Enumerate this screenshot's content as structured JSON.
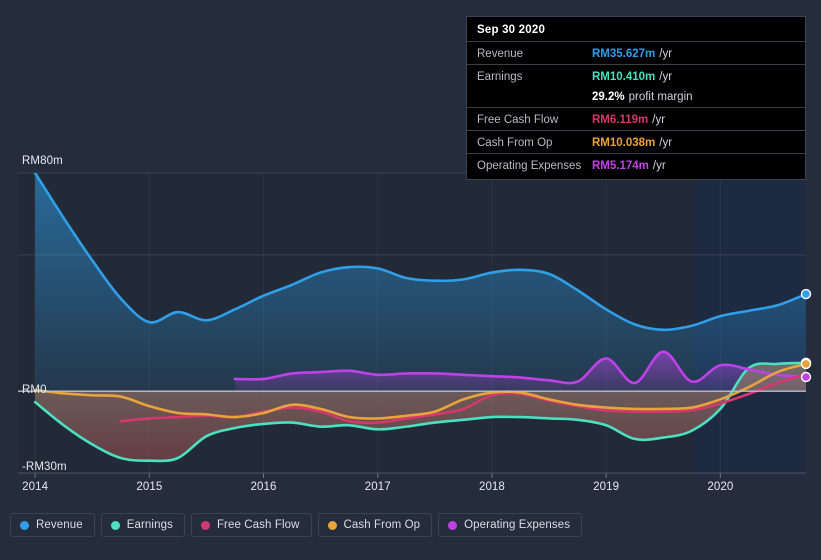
{
  "colors": {
    "background": "#252d3d",
    "plot_background": "#222a38",
    "forecast_background": "#1b2537",
    "gridline": "#3b4354",
    "zero_line": "#b9c0cc",
    "revenue": "#2e9fe8",
    "earnings": "#4ae0c0",
    "free_cash_flow": "#d6376f",
    "cash_from_op": "#e8a33d",
    "operating_expenses": "#bf42e8",
    "tooltip_bg": "#000000",
    "tooltip_border": "#3a4254",
    "text": "#e6e9ef",
    "text_muted": "#b7bcc6"
  },
  "tooltip": {
    "date": "Sep 30 2020",
    "rows": [
      {
        "name": "Revenue",
        "value": "RM35.627m",
        "unit": "/yr",
        "color": "#2e9fe8"
      },
      {
        "name": "Earnings",
        "value": "RM10.410m",
        "unit": "/yr",
        "color": "#4ae0c0"
      },
      {
        "name": "",
        "value": "29.2%",
        "unit": "profit margin",
        "color": "#ffffff",
        "sub": true
      },
      {
        "name": "Free Cash Flow",
        "value": "RM6.119m",
        "unit": "/yr",
        "color": "#d6376f"
      },
      {
        "name": "Cash From Op",
        "value": "RM10.038m",
        "unit": "/yr",
        "color": "#e8a33d"
      },
      {
        "name": "Operating Expenses",
        "value": "RM5.174m",
        "unit": "/yr",
        "color": "#bf42e8"
      }
    ]
  },
  "legend": {
    "items": [
      {
        "label": "Revenue",
        "color": "#2e9fe8",
        "icon": "legend-dot-icon"
      },
      {
        "label": "Earnings",
        "color": "#4ae0c0",
        "icon": "legend-dot-icon"
      },
      {
        "label": "Free Cash Flow",
        "color": "#d6376f",
        "icon": "legend-dot-icon"
      },
      {
        "label": "Cash From Op",
        "color": "#e8a33d",
        "icon": "legend-dot-icon"
      },
      {
        "label": "Operating Expenses",
        "color": "#bf42e8",
        "icon": "legend-dot-icon"
      }
    ]
  },
  "chart_data": {
    "type": "area",
    "title": "",
    "xlabel": "",
    "ylabel": "",
    "currency": "RM",
    "units": "m",
    "grid": true,
    "legend_position": "bottom",
    "ylim": [
      -30,
      80
    ],
    "xlim": [
      2013.85,
      2020.75
    ],
    "y_ticks": [
      {
        "value": 80,
        "label": "RM80m"
      },
      {
        "value": 50,
        "label": ""
      },
      {
        "value": 0,
        "label": "RM0"
      },
      {
        "value": -30,
        "label": "-RM30m"
      }
    ],
    "x_ticks": [
      {
        "value": 2014,
        "label": "2014"
      },
      {
        "value": 2015,
        "label": "2015"
      },
      {
        "value": 2016,
        "label": "2016"
      },
      {
        "value": 2017,
        "label": "2017"
      },
      {
        "value": 2018,
        "label": "2018"
      },
      {
        "value": 2019,
        "label": "2019"
      },
      {
        "value": 2020,
        "label": "2020"
      }
    ],
    "forecast_region": {
      "from": 2019.77,
      "to": 2020.75
    },
    "series": [
      {
        "name": "Revenue",
        "color": "#2e9fe8",
        "fill": true,
        "end_marker": true,
        "x": [
          2014.0,
          2014.25,
          2014.5,
          2014.75,
          2015.0,
          2015.25,
          2015.5,
          2015.75,
          2016.0,
          2016.25,
          2016.5,
          2016.75,
          2017.0,
          2017.25,
          2017.5,
          2017.75,
          2018.0,
          2018.25,
          2018.5,
          2018.75,
          2019.0,
          2019.25,
          2019.5,
          2019.75,
          2020.0,
          2020.25,
          2020.5,
          2020.75
        ],
        "y": [
          80.0,
          63.5,
          48.0,
          34.0,
          25.3,
          29.0,
          26.0,
          30.0,
          35.0,
          39.0,
          43.5,
          45.5,
          45.0,
          41.5,
          40.5,
          41.0,
          43.5,
          44.5,
          43.0,
          37.0,
          30.0,
          24.5,
          22.5,
          24.0,
          27.5,
          29.5,
          31.5,
          35.6
        ]
      },
      {
        "name": "Earnings",
        "color": "#4ae0c0",
        "fill": true,
        "end_marker": true,
        "x": [
          2014.0,
          2014.25,
          2014.5,
          2014.75,
          2015.0,
          2015.25,
          2015.5,
          2015.75,
          2016.0,
          2016.25,
          2016.5,
          2016.75,
          2017.0,
          2017.25,
          2017.5,
          2017.75,
          2018.0,
          2018.25,
          2018.5,
          2018.75,
          2019.0,
          2019.25,
          2019.5,
          2019.75,
          2020.0,
          2020.25,
          2020.5,
          2020.75
        ],
        "y": [
          -4.0,
          -12.5,
          -19.5,
          -24.5,
          -25.5,
          -24.5,
          -16.5,
          -13.5,
          -12.0,
          -11.5,
          -13.0,
          -12.5,
          -14.0,
          -13.0,
          -11.5,
          -10.5,
          -9.5,
          -9.5,
          -10.0,
          -10.5,
          -12.5,
          -17.5,
          -17.0,
          -14.5,
          -6.5,
          8.5,
          10.0,
          10.4
        ]
      },
      {
        "name": "Free Cash Flow",
        "color": "#d6376f",
        "fill": false,
        "end_marker": false,
        "x": [
          2014.75,
          2015.0,
          2015.25,
          2015.5,
          2015.75,
          2016.0,
          2016.25,
          2016.5,
          2016.75,
          2017.0,
          2017.25,
          2017.5,
          2017.75,
          2018.0,
          2018.25,
          2018.5,
          2018.75,
          2019.0,
          2019.25,
          2019.5,
          2019.75,
          2020.0,
          2020.25,
          2020.5,
          2020.75
        ],
        "y": [
          -11.0,
          -10.0,
          -9.5,
          -9.0,
          -9.5,
          -7.5,
          -6.0,
          -7.5,
          -11.0,
          -11.5,
          -10.0,
          -8.5,
          -6.5,
          -1.5,
          -1.0,
          -3.5,
          -5.5,
          -7.0,
          -7.5,
          -7.5,
          -7.0,
          -4.5,
          -1.0,
          3.0,
          6.1
        ]
      },
      {
        "name": "Cash From Op",
        "color": "#e8a33d",
        "fill": false,
        "end_marker": true,
        "x": [
          2014.0,
          2014.25,
          2014.5,
          2014.75,
          2015.0,
          2015.25,
          2015.5,
          2015.75,
          2016.0,
          2016.25,
          2016.5,
          2016.75,
          2017.0,
          2017.25,
          2017.5,
          2017.75,
          2018.0,
          2018.25,
          2018.5,
          2018.75,
          2019.0,
          2019.25,
          2019.5,
          2019.75,
          2020.0,
          2020.25,
          2020.5,
          2020.75
        ],
        "y": [
          0.4,
          -0.8,
          -1.5,
          -2.0,
          -5.5,
          -8.0,
          -8.5,
          -9.5,
          -8.0,
          -5.0,
          -6.5,
          -9.5,
          -10.0,
          -9.0,
          -7.5,
          -3.0,
          -0.5,
          -0.5,
          -3.0,
          -5.0,
          -6.0,
          -6.5,
          -6.5,
          -6.0,
          -3.0,
          1.5,
          7.0,
          10.0
        ]
      },
      {
        "name": "Operating Expenses",
        "color": "#bf42e8",
        "fill": true,
        "end_marker": true,
        "x": [
          2015.75,
          2016.0,
          2016.25,
          2016.5,
          2016.75,
          2017.0,
          2017.25,
          2017.5,
          2017.75,
          2018.0,
          2018.25,
          2018.5,
          2018.75,
          2019.0,
          2019.25,
          2019.5,
          2019.75,
          2020.0,
          2020.25,
          2020.5,
          2020.75
        ],
        "y": [
          4.5,
          4.5,
          6.5,
          7.0,
          7.5,
          6.0,
          6.5,
          6.5,
          6.0,
          5.5,
          5.0,
          4.0,
          3.5,
          12.0,
          3.0,
          14.5,
          3.5,
          9.5,
          8.0,
          6.0,
          5.2
        ]
      }
    ]
  }
}
